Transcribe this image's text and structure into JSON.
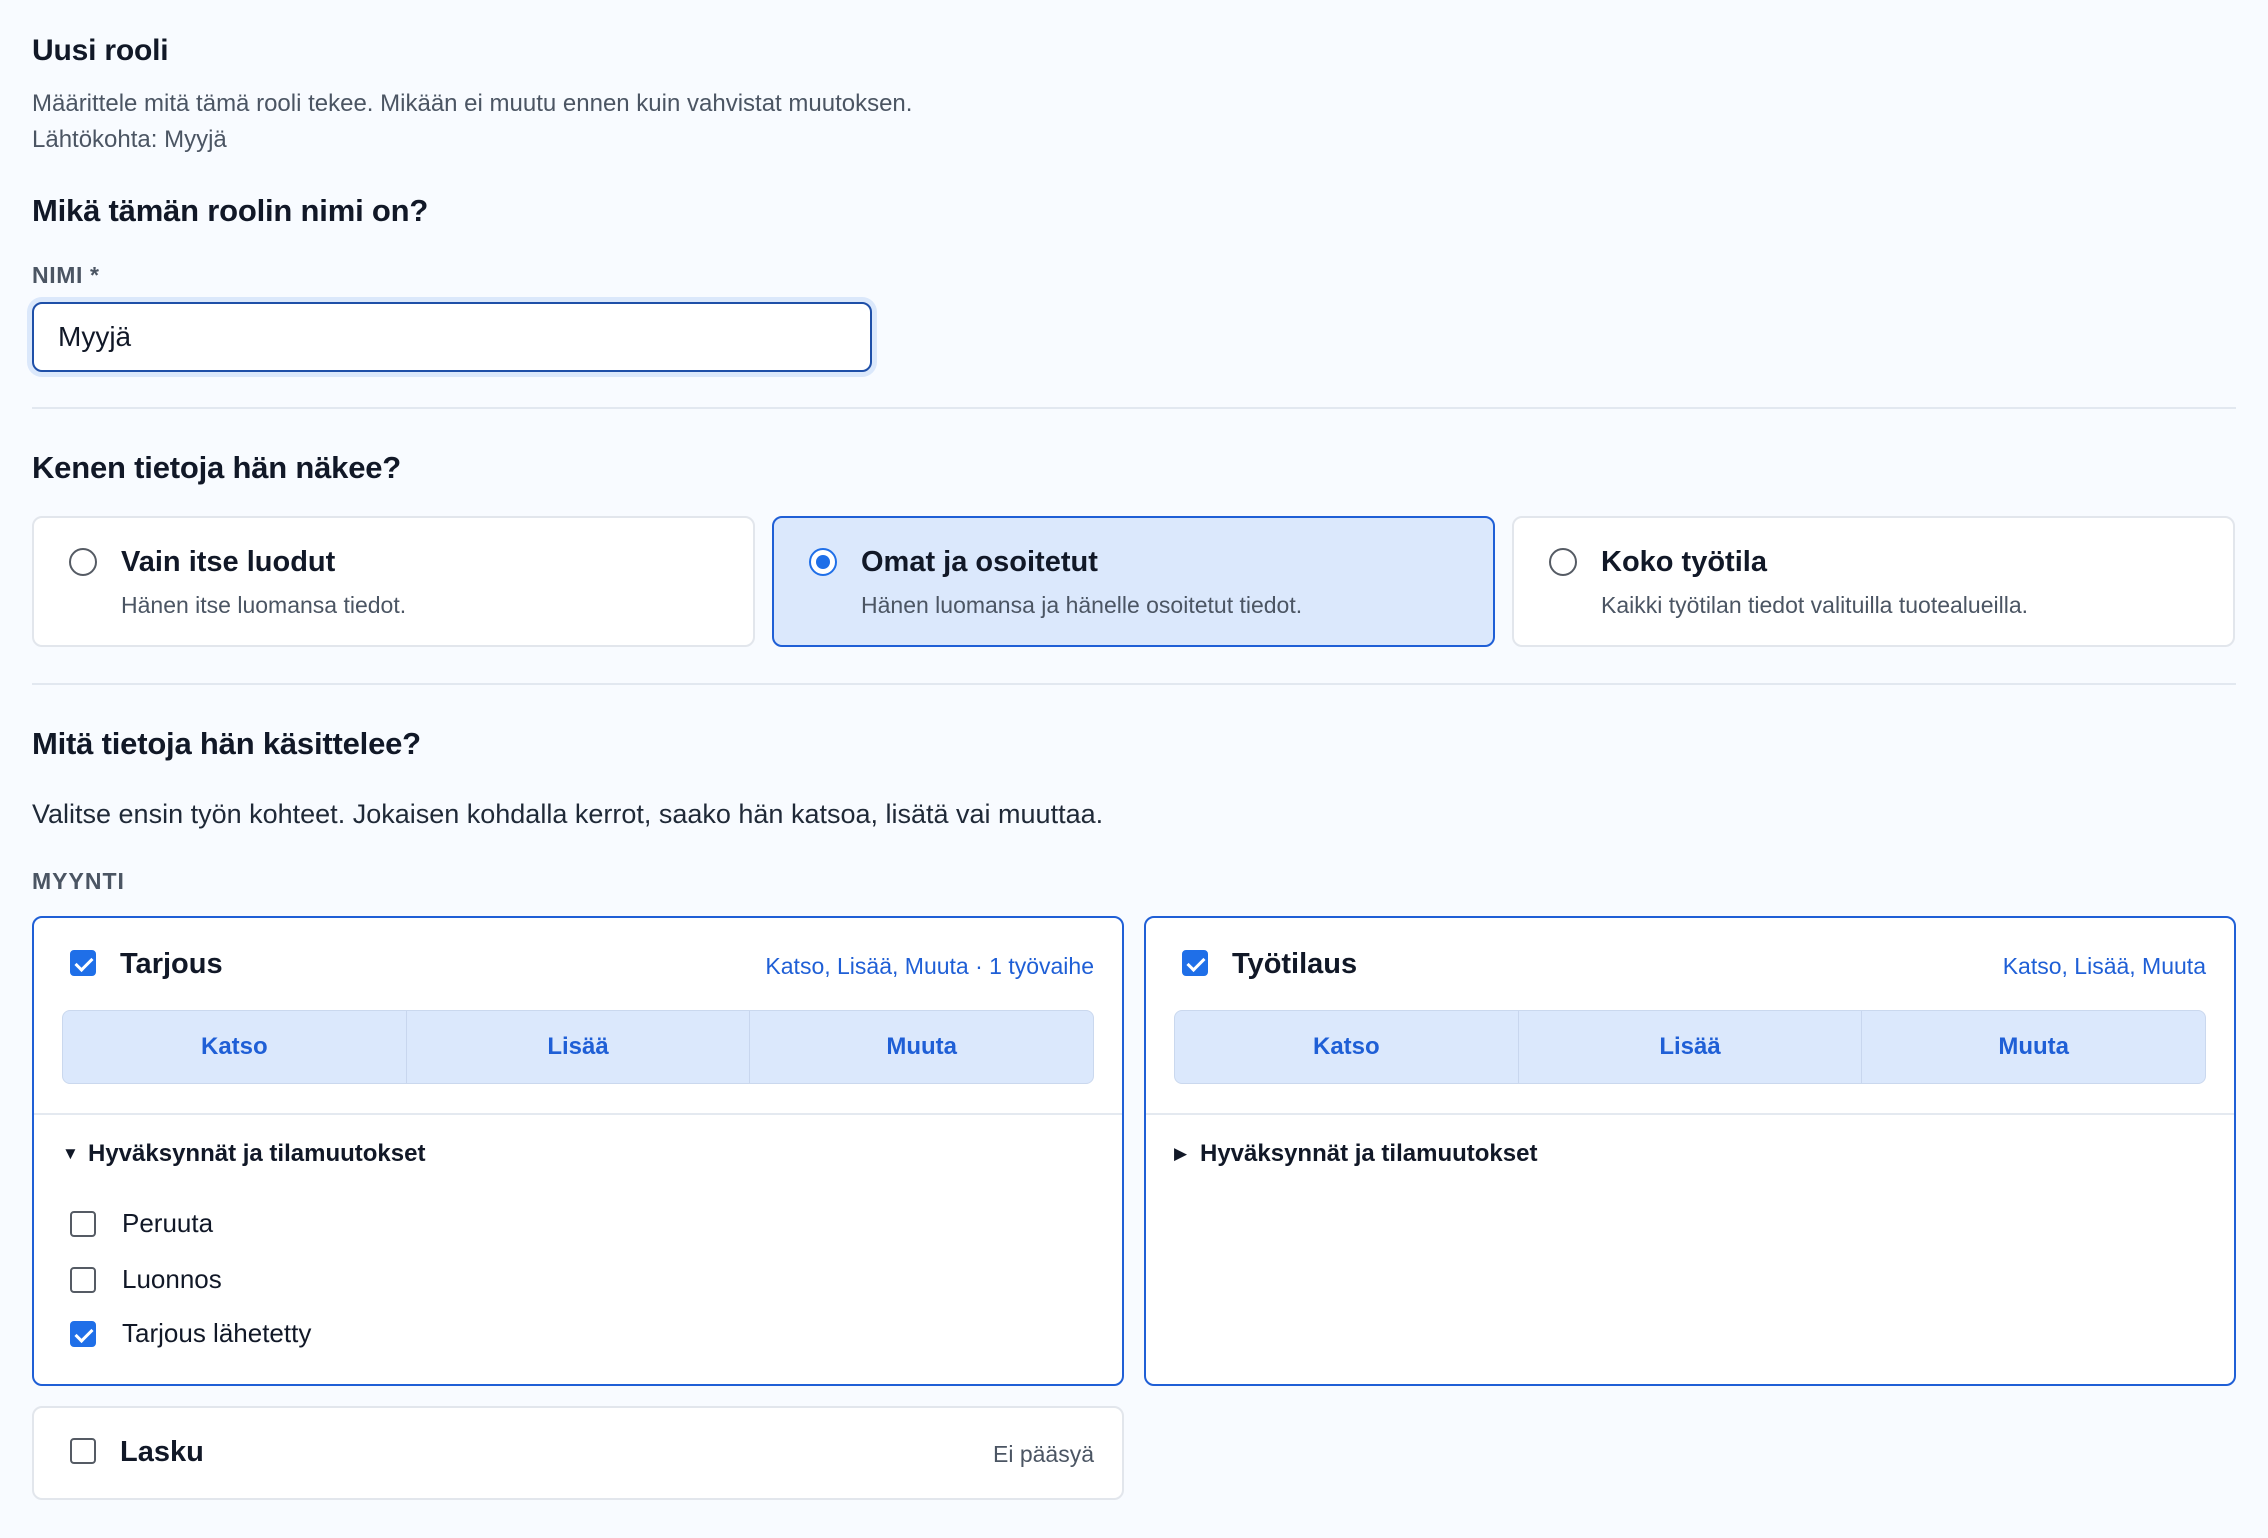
{
  "header": {
    "title": "Uusi rooli",
    "subtitle": "Määrittele mitä tämä rooli tekee. Mikään ei muutu ennen kuin vahvistat muutoksen.",
    "origin": "Lähtökohta: Myyjä"
  },
  "name_section": {
    "heading": "Mikä tämän roolin nimi on?",
    "label": "NIMI *",
    "value": "Myyjä"
  },
  "scope_section": {
    "heading": "Kenen tietoja hän näkee?",
    "options": [
      {
        "title": "Vain itse luodut",
        "desc": "Hänen itse luomansa tiedot.",
        "selected": false
      },
      {
        "title": "Omat ja osoitetut",
        "desc": "Hänen luomansa ja hänelle osoitetut tiedot.",
        "selected": true
      },
      {
        "title": "Koko työtila",
        "desc": "Kaikki työtilan tiedot valituilla tuotealueilla.",
        "selected": false
      }
    ]
  },
  "data_section": {
    "heading": "Mitä tietoja hän käsittelee?",
    "lead": "Valitse ensin työn kohteet. Jokaisen kohdalla kerrot, saako hän katsoa, lisätä vai muuttaa.",
    "group_label": "MYYNTI",
    "entities": [
      {
        "name": "Tarjous",
        "checked": true,
        "summary": "Katso, Lisää, Muuta · 1 työvaihe",
        "actions": [
          "Katso",
          "Lisää",
          "Muuta"
        ],
        "details_label": "Hyväksynnät ja tilamuutokset",
        "details_open": true,
        "steps": [
          {
            "label": "Peruuta",
            "checked": false
          },
          {
            "label": "Luonnos",
            "checked": false
          },
          {
            "label": "Tarjous lähetetty",
            "checked": true
          }
        ]
      },
      {
        "name": "Työtilaus",
        "checked": true,
        "summary": "Katso, Lisää, Muuta",
        "actions": [
          "Katso",
          "Lisää",
          "Muuta"
        ],
        "details_label": "Hyväksynnät ja tilamuutokset",
        "details_open": false
      },
      {
        "name": "Lasku",
        "checked": false,
        "summary": "Ei pääsyä"
      }
    ]
  },
  "colors": {
    "accent": "#1f6fe8",
    "accent_dark": "#1f5fd6",
    "selected_bg": "#dbe8fc",
    "page_bg": "#f8fbff"
  }
}
